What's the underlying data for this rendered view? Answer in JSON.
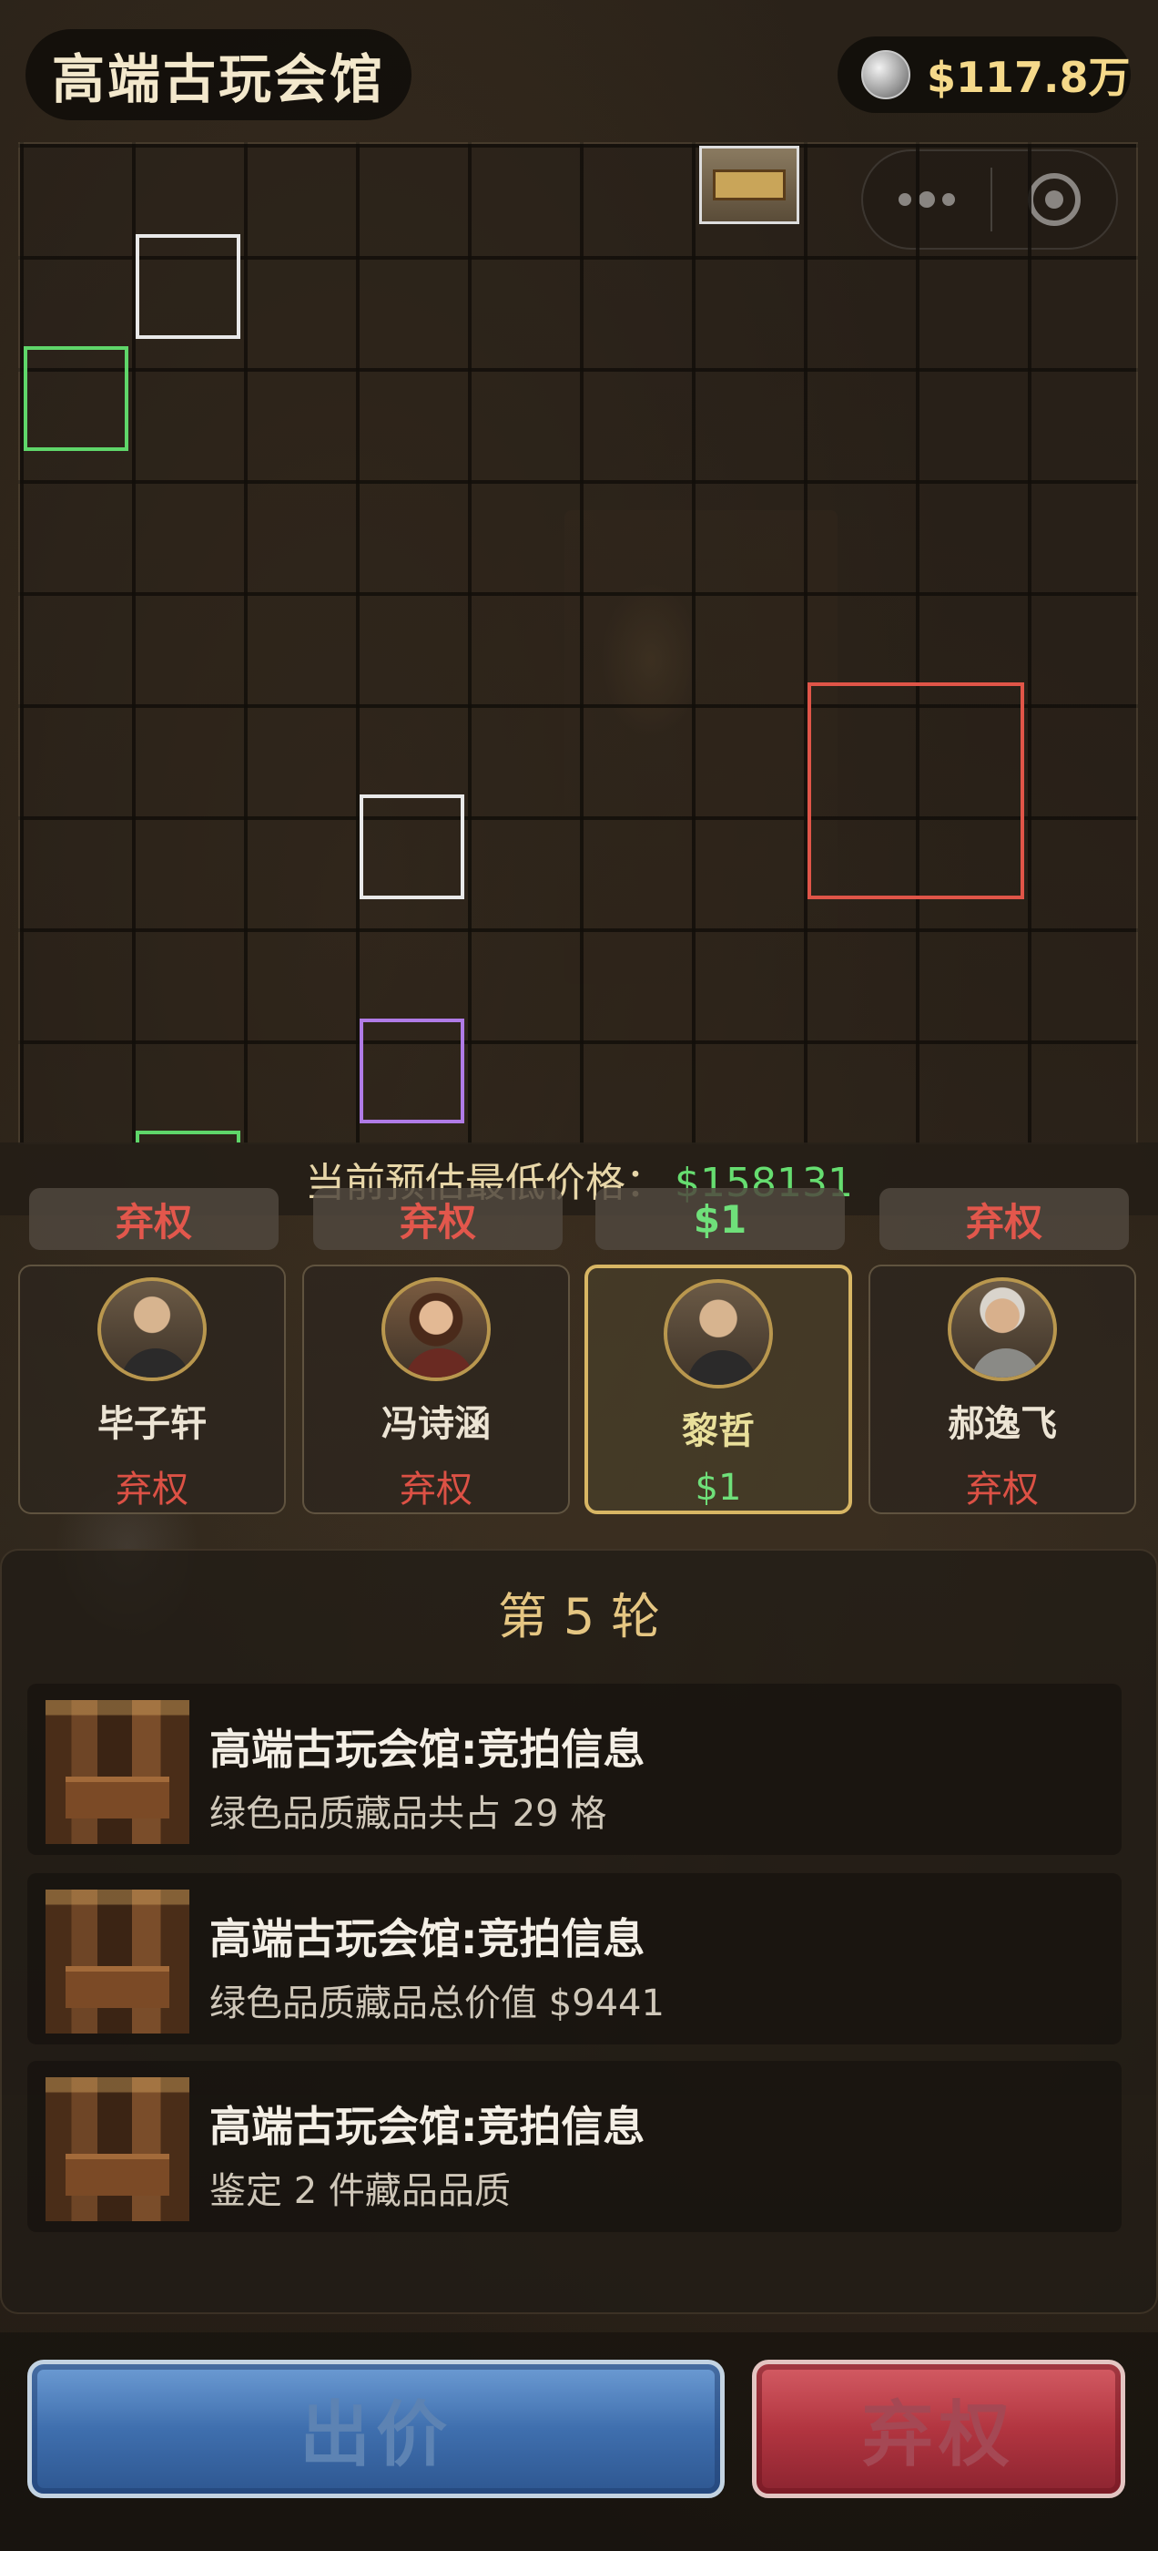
{
  "header": {
    "title": "高端古玩会馆",
    "money": "$117.8万"
  },
  "icons": {
    "coin": "coin-icon",
    "more": "more-dots-icon",
    "close": "target-close-icon"
  },
  "price": {
    "label": "当前预估最低价格：",
    "value": "$158131"
  },
  "bid_tags": [
    "弃权",
    "弃权",
    "$1",
    "弃权"
  ],
  "players": [
    {
      "name": "毕子轩",
      "status": "弃权"
    },
    {
      "name": "冯诗涵",
      "status": "弃权"
    },
    {
      "name": "黎哲",
      "status": "$1"
    },
    {
      "name": "郝逸飞",
      "status": "弃权"
    }
  ],
  "round": {
    "prefix": "第",
    "number": "5",
    "suffix": "轮"
  },
  "messages": [
    {
      "title": "高端古玩会馆:竞拍信息",
      "body": "绿色品质藏品共占 29 格"
    },
    {
      "title": "高端古玩会馆:竞拍信息",
      "body": "绿色品质藏品总价值 $9441"
    },
    {
      "title": "高端古玩会馆:竞拍信息",
      "body": "鉴定 2 件藏品品质"
    }
  ],
  "buttons": {
    "bid": "出价",
    "fold": "弃权"
  },
  "colors": {
    "green_quality": "#5fd66a",
    "red_quality": "#e05548",
    "purple_quality": "#b07be6",
    "white_quality": "#e9e9e9",
    "gold_accent": "#e5c682",
    "fold_red": "#dc5145",
    "bid_green": "#6fe07a"
  }
}
